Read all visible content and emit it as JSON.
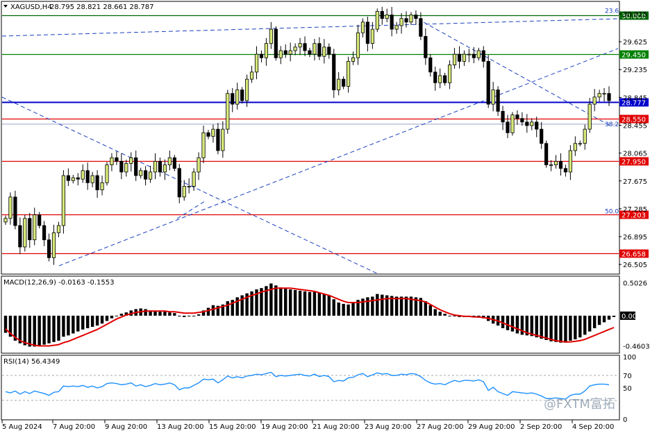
{
  "header": {
    "symbol": "XAGUSD,H4",
    "ohlc": "28.795 28.821 28.661 28.787"
  },
  "chart_data": {
    "type": "candlestick",
    "symbol": "XAGUSD",
    "timeframe": "H4",
    "price_axis_ticks": [
      30.015,
      29.625,
      29.235,
      28.845,
      28.455,
      28.065,
      27.675,
      27.285,
      26.895,
      26.505
    ],
    "price_range": [
      26.38,
      30.18
    ],
    "time_axis_labels": [
      "5 Aug 2024",
      "7 Aug 20:00",
      "9 Aug 20:00",
      "13 Aug 20:00",
      "15 Aug 20:00",
      "19 Aug 20:00",
      "21 Aug 20:00",
      "23 Aug 20:00",
      "27 Aug 20:00",
      "29 Aug 20:00",
      "2 Sep 20:00",
      "4 Sep 20:00"
    ],
    "horizontal_levels": [
      {
        "price": 30.0,
        "label": "30.000",
        "color": "#006400"
      },
      {
        "price": 29.45,
        "label": "29.450",
        "color": "#008000"
      },
      {
        "price": 28.777,
        "label": "28.777",
        "color": "#0000cc"
      },
      {
        "price": 28.55,
        "label": "28.550",
        "color": "#e00000"
      },
      {
        "price": 27.95,
        "label": "27.950",
        "color": "#e00000"
      },
      {
        "price": 27.203,
        "label": "27.203",
        "color": "#e00000"
      },
      {
        "price": 26.658,
        "label": "26.658",
        "color": "#e00000"
      }
    ],
    "fib_labels": [
      {
        "text": "23.6",
        "price": 30.06
      },
      {
        "text": "38.2",
        "price": 28.47
      },
      {
        "text": "50.0",
        "price": 27.25
      }
    ],
    "candles_close": [
      27.15,
      27.45,
      27.05,
      26.75,
      27.15,
      26.85,
      27.2,
      27.05,
      26.85,
      26.6,
      26.95,
      27.05,
      27.75,
      27.68,
      27.72,
      27.7,
      27.82,
      27.65,
      27.75,
      27.55,
      27.65,
      27.9,
      28.0,
      27.95,
      27.8,
      27.92,
      28.0,
      27.75,
      27.82,
      27.7,
      27.8,
      27.95,
      27.8,
      27.9,
      28.0,
      27.85,
      27.45,
      27.6,
      27.6,
      27.8,
      28.0,
      28.35,
      28.3,
      28.4,
      28.1,
      28.4,
      28.9,
      28.75,
      28.95,
      28.8,
      29.1,
      29.2,
      29.45,
      29.4,
      29.6,
      29.8,
      29.4,
      29.5,
      29.45,
      29.5,
      29.55,
      29.6,
      29.5,
      29.45,
      29.6,
      29.42,
      29.55,
      29.45,
      28.95,
      29.1,
      29.0,
      29.35,
      29.4,
      29.75,
      29.9,
      29.6,
      29.8,
      30.05,
      29.95,
      30.0,
      29.8,
      29.85,
      29.95,
      29.9,
      30.0,
      29.95,
      29.7,
      29.4,
      29.2,
      29.05,
      29.15,
      29.05,
      29.3,
      29.45,
      29.35,
      29.45,
      29.45,
      29.4,
      29.5,
      29.35,
      28.75,
      28.95,
      28.65,
      28.5,
      28.35,
      28.6,
      28.55,
      28.5,
      28.45,
      28.5,
      28.4,
      28.2,
      27.9,
      27.9,
      27.95,
      27.85,
      27.8,
      28.1,
      28.2,
      28.2,
      28.4,
      28.75,
      28.85,
      28.9,
      28.9,
      28.8
    ]
  },
  "macd": {
    "label": "MACD(12,26,9) -0.0163 -0.1553",
    "ticks": [
      "0.5026",
      "0.00",
      "-0.4603"
    ],
    "range": [
      -0.56,
      0.58
    ],
    "histogram": [
      -0.26,
      -0.32,
      -0.38,
      -0.42,
      -0.45,
      -0.47,
      -0.47,
      -0.46,
      -0.44,
      -0.42,
      -0.4,
      -0.38,
      -0.32,
      -0.3,
      -0.27,
      -0.24,
      -0.21,
      -0.19,
      -0.17,
      -0.15,
      -0.12,
      -0.08,
      -0.04,
      0.0,
      0.03,
      0.05,
      0.08,
      0.1,
      0.11,
      0.1,
      0.08,
      0.07,
      0.06,
      0.06,
      0.05,
      0.04,
      0.0,
      -0.02,
      -0.01,
      0.0,
      0.02,
      0.08,
      0.12,
      0.16,
      0.15,
      0.17,
      0.22,
      0.24,
      0.28,
      0.31,
      0.34,
      0.37,
      0.4,
      0.42,
      0.45,
      0.49,
      0.46,
      0.43,
      0.41,
      0.4,
      0.39,
      0.38,
      0.37,
      0.36,
      0.36,
      0.35,
      0.33,
      0.31,
      0.25,
      0.2,
      0.18,
      0.17,
      0.2,
      0.24,
      0.26,
      0.28,
      0.29,
      0.33,
      0.32,
      0.31,
      0.3,
      0.29,
      0.29,
      0.29,
      0.29,
      0.28,
      0.27,
      0.22,
      0.16,
      0.1,
      0.06,
      0.03,
      0.0,
      -0.01,
      -0.02,
      -0.02,
      -0.02,
      -0.02,
      -0.03,
      -0.04,
      -0.08,
      -0.12,
      -0.15,
      -0.19,
      -0.22,
      -0.24,
      -0.27,
      -0.29,
      -0.3,
      -0.31,
      -0.33,
      -0.35,
      -0.37,
      -0.39,
      -0.4,
      -0.41,
      -0.41,
      -0.38,
      -0.36,
      -0.33,
      -0.29,
      -0.24,
      -0.19,
      -0.14,
      -0.1,
      -0.06,
      -0.02
    ],
    "signal": [
      -0.2,
      -0.27,
      -0.33,
      -0.38,
      -0.41,
      -0.43,
      -0.45,
      -0.46,
      -0.46,
      -0.46,
      -0.45,
      -0.44,
      -0.41,
      -0.39,
      -0.36,
      -0.33,
      -0.3,
      -0.27,
      -0.24,
      -0.21,
      -0.17,
      -0.13,
      -0.09,
      -0.05,
      -0.02,
      0.01,
      0.03,
      0.05,
      0.06,
      0.07,
      0.07,
      0.07,
      0.07,
      0.07,
      0.06,
      0.06,
      0.05,
      0.04,
      0.04,
      0.04,
      0.05,
      0.06,
      0.08,
      0.1,
      0.12,
      0.14,
      0.16,
      0.19,
      0.22,
      0.25,
      0.28,
      0.31,
      0.33,
      0.36,
      0.38,
      0.4,
      0.42,
      0.42,
      0.42,
      0.42,
      0.41,
      0.4,
      0.39,
      0.38,
      0.37,
      0.35,
      0.33,
      0.31,
      0.28,
      0.25,
      0.22,
      0.2,
      0.2,
      0.2,
      0.21,
      0.22,
      0.23,
      0.24,
      0.25,
      0.26,
      0.26,
      0.26,
      0.26,
      0.26,
      0.25,
      0.24,
      0.23,
      0.21,
      0.17,
      0.13,
      0.09,
      0.06,
      0.03,
      0.01,
      0.0,
      -0.01,
      -0.01,
      -0.02,
      -0.02,
      -0.03,
      -0.04,
      -0.06,
      -0.08,
      -0.11,
      -0.14,
      -0.17,
      -0.2,
      -0.23,
      -0.26,
      -0.28,
      -0.3,
      -0.32,
      -0.34,
      -0.36,
      -0.38,
      -0.39,
      -0.4,
      -0.4,
      -0.39,
      -0.38,
      -0.36,
      -0.33,
      -0.3,
      -0.27,
      -0.24,
      -0.21,
      -0.18
    ]
  },
  "rsi": {
    "label": "RSI(14) 56.4349",
    "ticks": [
      "100",
      "70",
      "50",
      "0"
    ],
    "levels": [
      70,
      30
    ],
    "values": [
      44,
      42,
      45,
      40,
      44,
      41,
      45,
      43,
      41,
      38,
      43,
      44,
      53,
      52,
      53,
      52,
      54,
      51,
      53,
      50,
      52,
      57,
      58,
      57,
      55,
      56,
      58,
      53,
      55,
      52,
      54,
      57,
      55,
      56,
      58,
      55,
      47,
      50,
      50,
      54,
      58,
      64,
      63,
      64,
      58,
      63,
      69,
      66,
      68,
      66,
      69,
      70,
      72,
      71,
      73,
      75,
      68,
      70,
      69,
      70,
      71,
      72,
      70,
      69,
      72,
      68,
      70,
      68,
      60,
      62,
      61,
      66,
      67,
      71,
      73,
      68,
      71,
      74,
      72,
      73,
      70,
      70,
      72,
      71,
      73,
      72,
      68,
      62,
      58,
      56,
      57,
      55,
      59,
      62,
      60,
      62,
      62,
      61,
      63,
      60,
      46,
      51,
      44,
      41,
      38,
      44,
      43,
      42,
      41,
      42,
      40,
      37,
      33,
      33,
      34,
      33,
      32,
      38,
      40,
      40,
      45,
      53,
      55,
      56,
      56,
      55
    ]
  },
  "watermark": "@FXTM富拓",
  "colors": {
    "bull_fill": "#d7e87a",
    "bear_fill": "#000000",
    "macd_signal": "#e00000",
    "rsi_line": "#1e90ff",
    "trendline": "#1a3fbf"
  }
}
